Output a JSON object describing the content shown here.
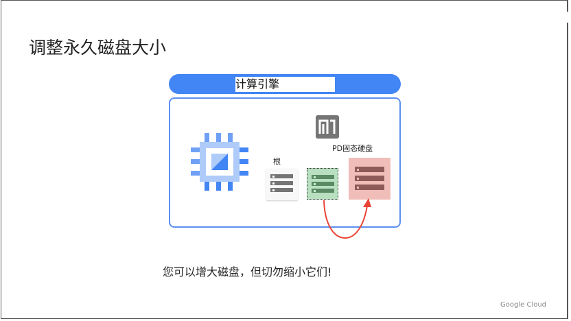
{
  "slide": {
    "title": "调整永久磁盘大小",
    "banner_label": "计算引擎",
    "root_label": "根",
    "ssd_label": "PD固态硬盘",
    "caption": "您可以增大磁盘，但切勿缩小它们!",
    "footer_logo": "Google Cloud"
  },
  "icons": [
    "cpu-icon",
    "n1-machine-icon",
    "root-disk-icon",
    "pd-disk-icon",
    "ssd-disk-icon",
    "resize-arrow-icon"
  ],
  "colors": {
    "accent": "#4285f4",
    "root_disk": "#f8f8f8",
    "pd_disk": "#b7dfc0",
    "ssd_disk": "#f0bdb8",
    "arrow": "#ea4335"
  }
}
